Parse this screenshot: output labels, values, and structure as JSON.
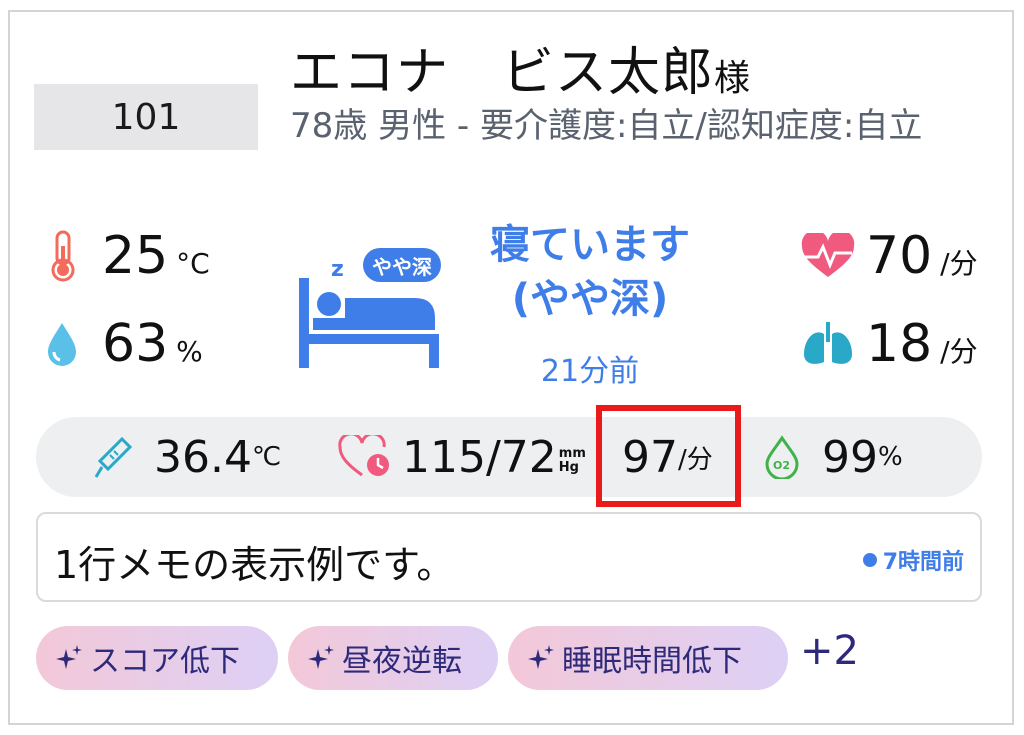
{
  "room": "101",
  "resident": {
    "name": "エコナ　ビス太郎",
    "honorific": "様",
    "details": "78歳 男性 - 要介護度:自立/認知症度:自立"
  },
  "environment": {
    "temperature": {
      "value": "25",
      "unit": "°C",
      "icon": "thermometer-icon"
    },
    "humidity": {
      "value": "63",
      "unit": "%",
      "icon": "water-drop-icon"
    },
    "heart_rate": {
      "value": "70",
      "unit": "/分",
      "icon": "heart-pulse-icon"
    },
    "respiration": {
      "value": "18",
      "unit": "/分",
      "icon": "lungs-icon"
    }
  },
  "sleep_status": {
    "badge": "やや深",
    "line1": "寝ています",
    "line2": "(やや深)",
    "ago": "21分前",
    "icon": "bed-sleep-icon"
  },
  "vitals": {
    "body_temp": {
      "value": "36.4",
      "unit": "℃"
    },
    "blood_pressure": {
      "value": "115/72",
      "unit_top": "mm",
      "unit_bottom": "Hg"
    },
    "pulse": {
      "value": "97",
      "unit": "/分"
    },
    "spo2": {
      "value": "99",
      "unit": "%"
    }
  },
  "memo": {
    "text": "1行メモの表示例です。",
    "time": "7時間前"
  },
  "tags": [
    "スコア低下",
    "昼夜逆転",
    "睡眠時間低下"
  ],
  "more_tags": "+2",
  "colors": {
    "accent_blue": "#3f7ee8",
    "highlight_red": "#e81a1a",
    "tag_text": "#2e2a7a",
    "heart_pink": "#f05a7e",
    "lung_teal": "#2aa8c8"
  }
}
